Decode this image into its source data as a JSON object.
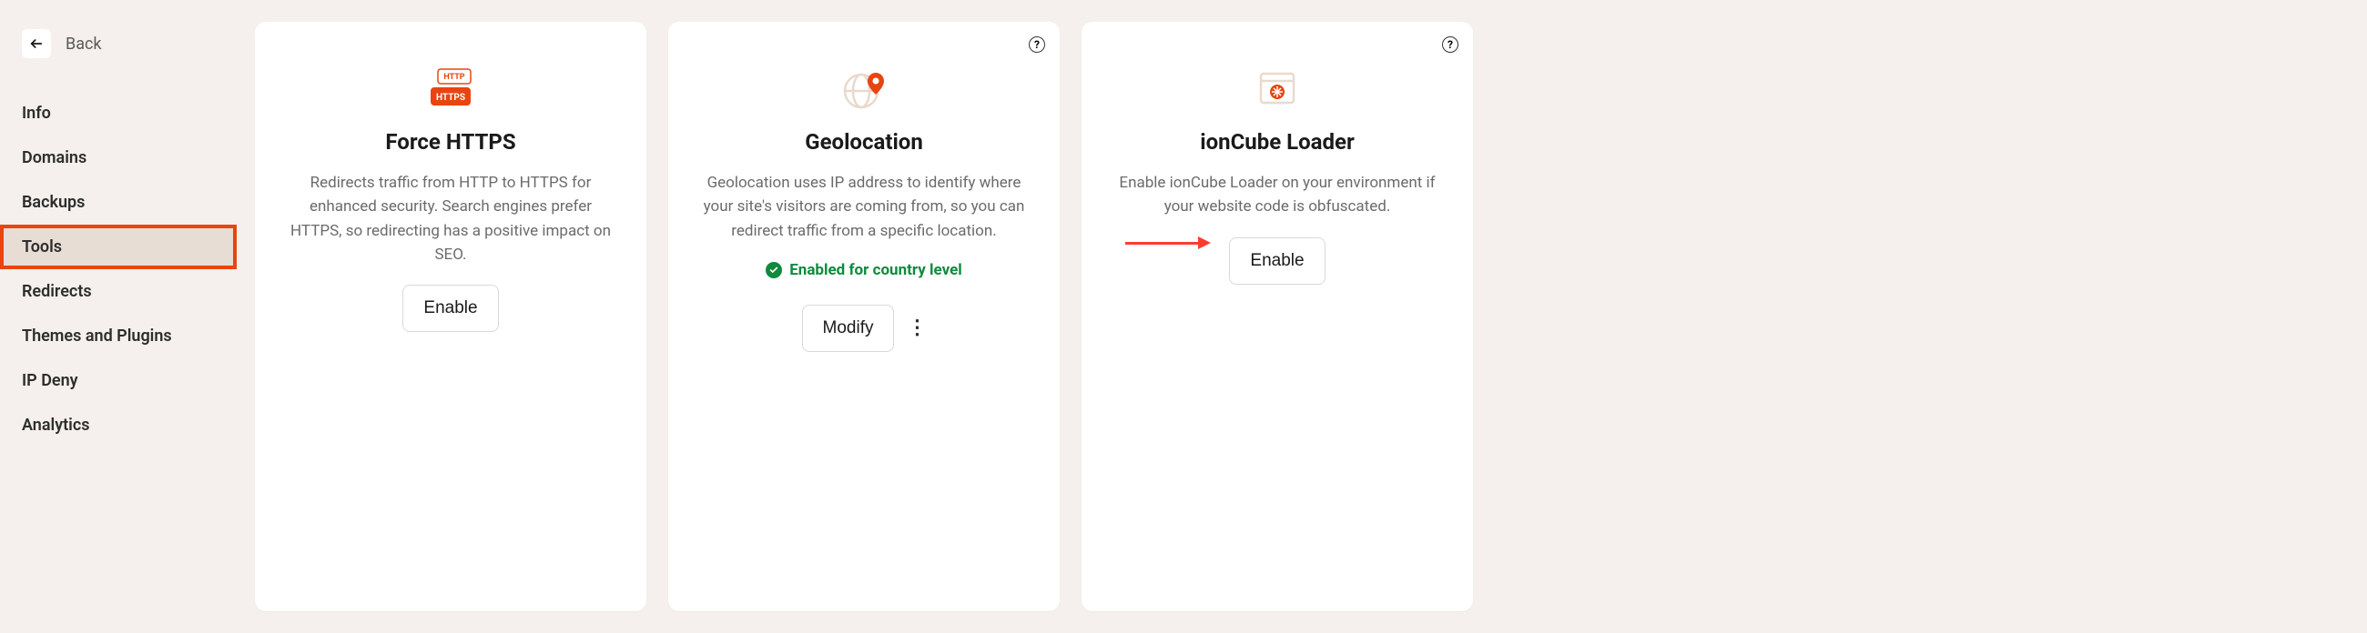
{
  "sidebar": {
    "back_label": "Back",
    "items": [
      {
        "label": "Info",
        "active": false
      },
      {
        "label": "Domains",
        "active": false
      },
      {
        "label": "Backups",
        "active": false
      },
      {
        "label": "Tools",
        "active": true
      },
      {
        "label": "Redirects",
        "active": false
      },
      {
        "label": "Themes and Plugins",
        "active": false
      },
      {
        "label": "IP Deny",
        "active": false
      },
      {
        "label": "Analytics",
        "active": false
      }
    ]
  },
  "cards": {
    "https": {
      "title": "Force HTTPS",
      "desc": "Redirects traffic from HTTP to HTTPS for enhanced security. Search engines prefer HTTPS, so redirecting has a positive impact on SEO.",
      "action_label": "Enable",
      "badge_http": "HTTP",
      "badge_https": "HTTPS"
    },
    "geo": {
      "title": "Geolocation",
      "desc": "Geolocation uses IP address to identify where your site's visitors are coming from, so you can redirect traffic from a specific location.",
      "status": "Enabled for country level",
      "action_label": "Modify"
    },
    "ioncube": {
      "title": "ionCube Loader",
      "desc": "Enable ionCube Loader on your environment if your website code is obfuscated.",
      "action_label": "Enable"
    }
  }
}
